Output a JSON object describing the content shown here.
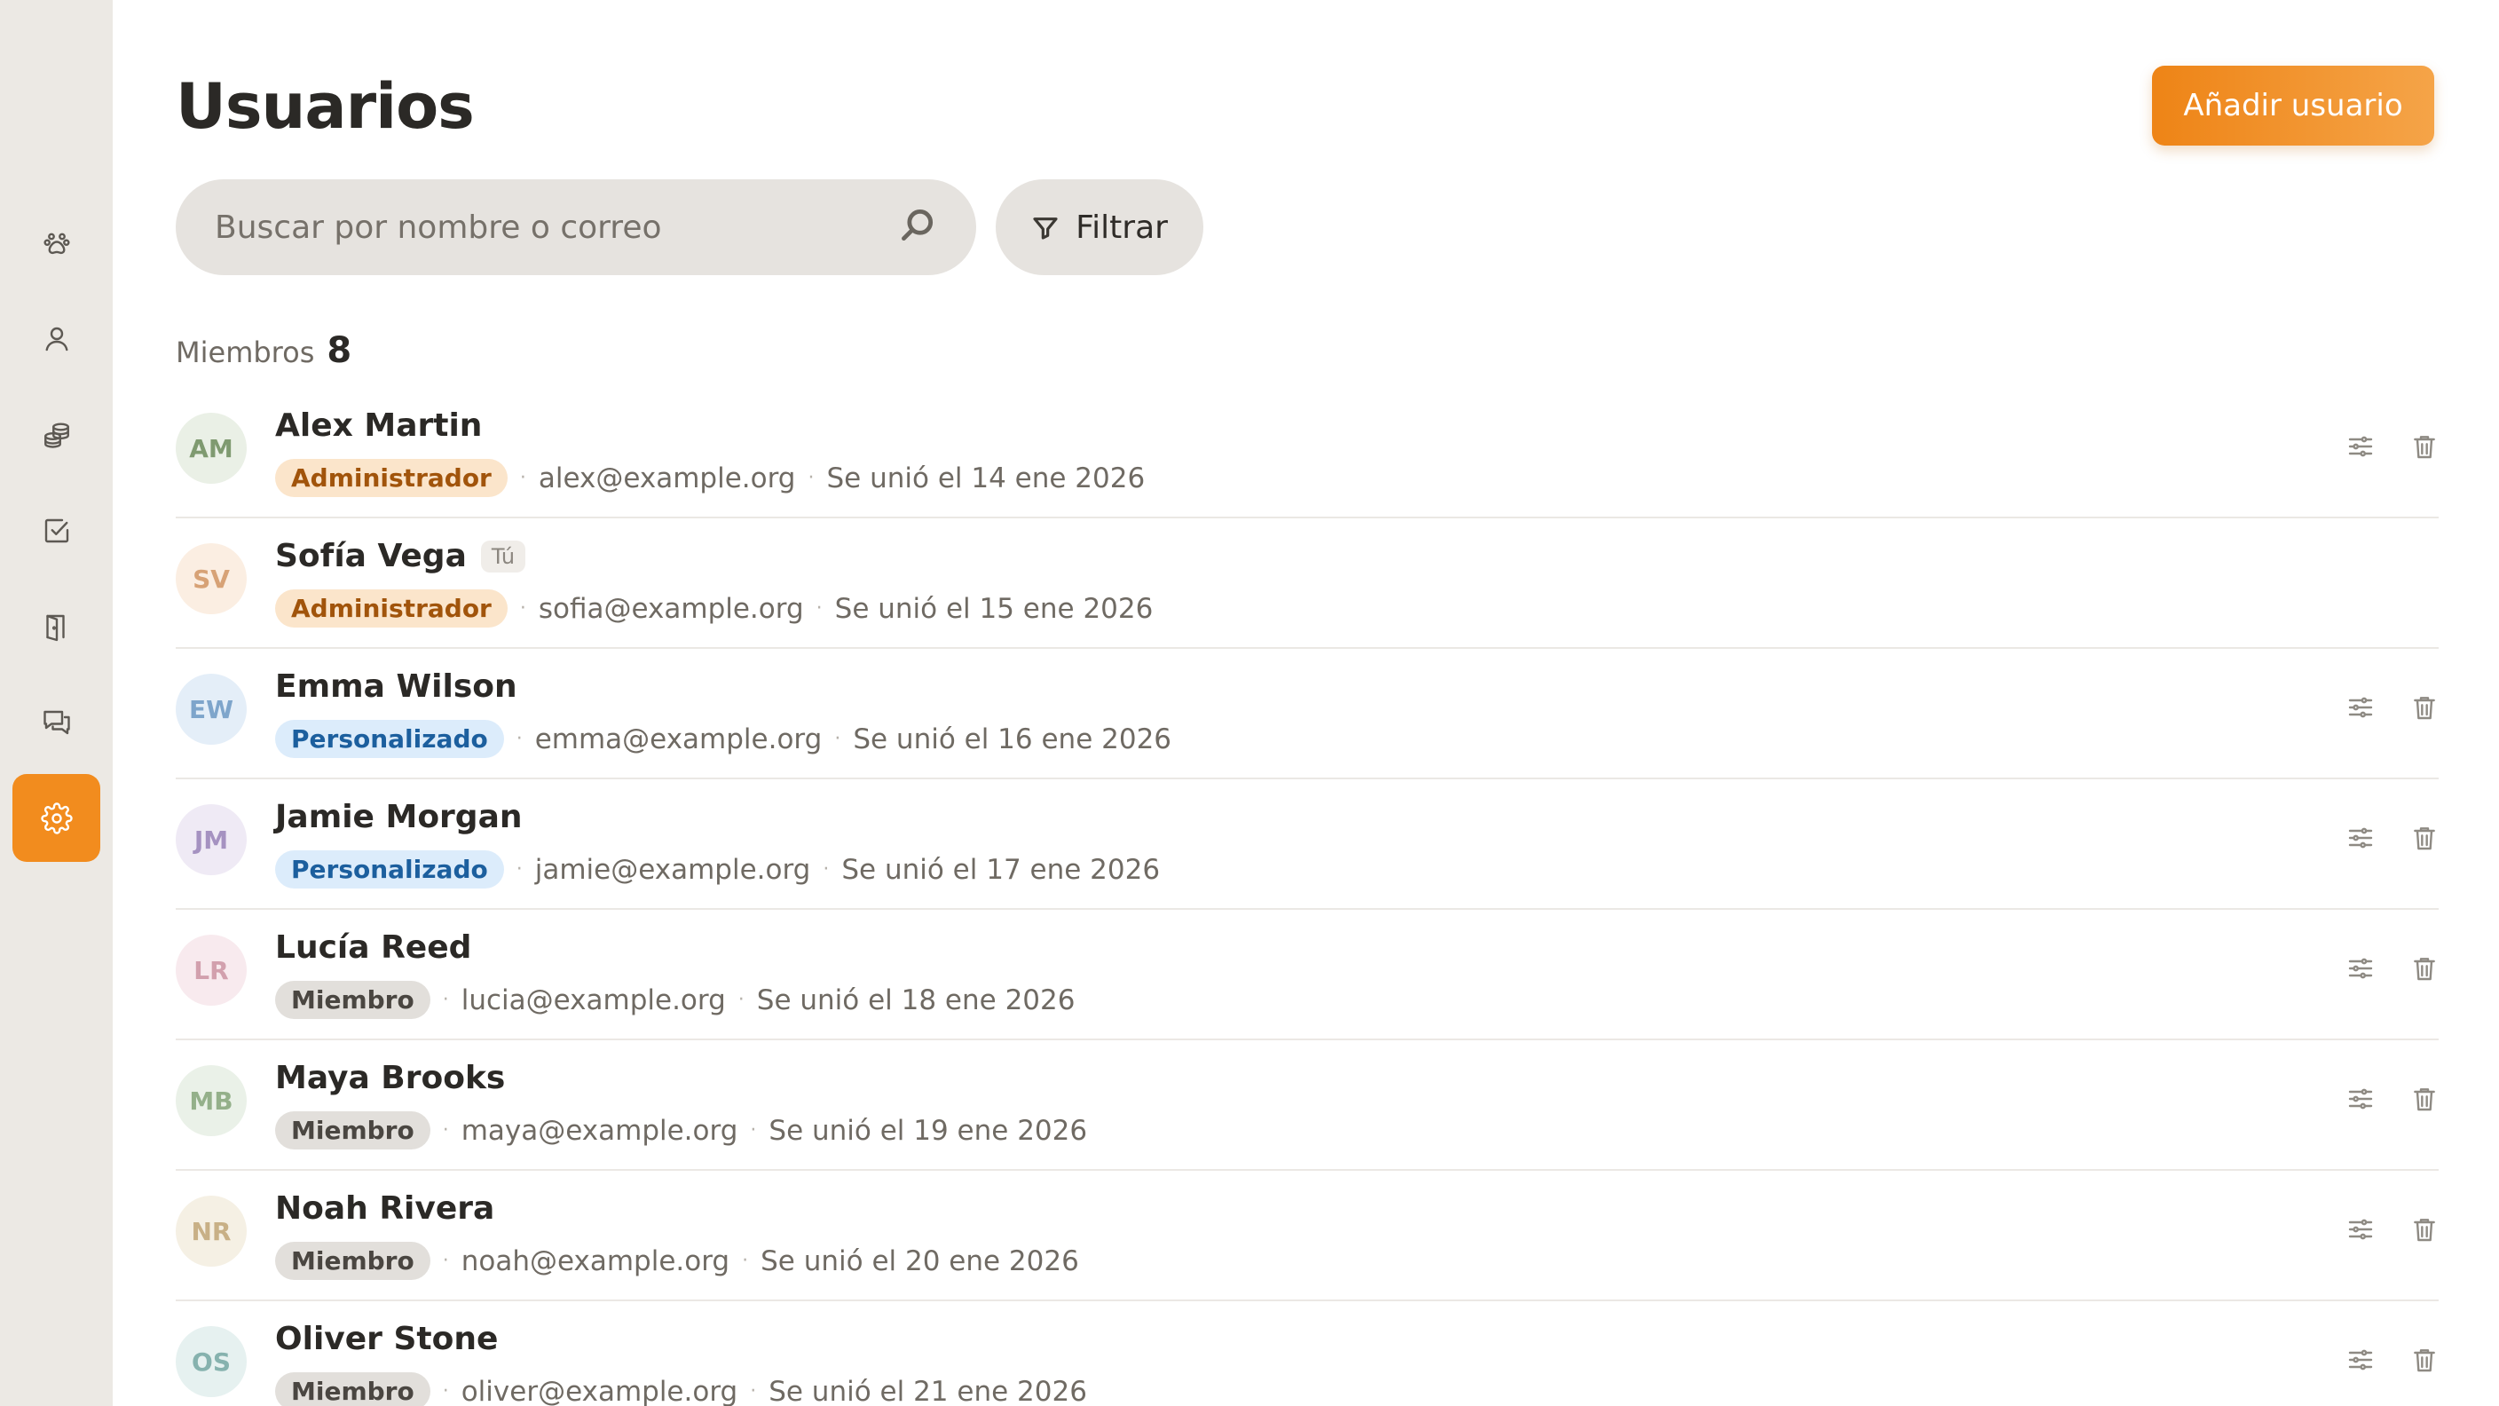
{
  "page": {
    "title": "Usuarios",
    "add_button": "Añadir usuario"
  },
  "search": {
    "placeholder": "Buscar por nombre o correo"
  },
  "filter": {
    "label": "Filtrar"
  },
  "members": {
    "label": "Miembros",
    "count": "8"
  },
  "colors": {
    "accent": "#f28c1e",
    "sidebar_bg": "#ece9e4"
  },
  "sidebar": {
    "items": [
      {
        "icon": "paw-icon",
        "active": false
      },
      {
        "icon": "user-icon",
        "active": false
      },
      {
        "icon": "coins-icon",
        "active": false
      },
      {
        "icon": "checkbox-icon",
        "active": false
      },
      {
        "icon": "door-icon",
        "active": false
      },
      {
        "icon": "chat-icon",
        "active": false
      },
      {
        "icon": "gear-icon",
        "active": true
      }
    ]
  },
  "users": [
    {
      "initials": "AM",
      "name": "Alex Martin",
      "you": "",
      "role": "Administrador",
      "role_type": "admin",
      "email": "alex@example.org",
      "joined": "Se unió el 14 ene 2026",
      "avatar_bg": "#eaf0e6",
      "avatar_fg": "#7f9a70",
      "actions": true
    },
    {
      "initials": "SV",
      "name": "Sofía Vega",
      "you": "Tú",
      "role": "Administrador",
      "role_type": "admin",
      "email": "sofia@example.org",
      "joined": "Se unió el 15 ene 2026",
      "avatar_bg": "#fbeee2",
      "avatar_fg": "#d7a276",
      "actions": false
    },
    {
      "initials": "EW",
      "name": "Emma Wilson",
      "you": "",
      "role": "Personalizado",
      "role_type": "custom",
      "email": "emma@example.org",
      "joined": "Se unió el 16 ene 2026",
      "avatar_bg": "#e4eef8",
      "avatar_fg": "#7ea5cb",
      "actions": true
    },
    {
      "initials": "JM",
      "name": "Jamie Morgan",
      "you": "",
      "role": "Personalizado",
      "role_type": "custom",
      "email": "jamie@example.org",
      "joined": "Se unió el 17 ene 2026",
      "avatar_bg": "#efeaf5",
      "avatar_fg": "#a592c1",
      "actions": true
    },
    {
      "initials": "LR",
      "name": "Lucía Reed",
      "you": "",
      "role": "Miembro",
      "role_type": "member",
      "email": "lucia@example.org",
      "joined": "Se unió el 18 ene 2026",
      "avatar_bg": "#f8eaee",
      "avatar_fg": "#d2a0ad",
      "actions": true
    },
    {
      "initials": "MB",
      "name": "Maya Brooks",
      "you": "",
      "role": "Miembro",
      "role_type": "member",
      "email": "maya@example.org",
      "joined": "Se unió el 19 ene 2026",
      "avatar_bg": "#eaf1e8",
      "avatar_fg": "#94b08a",
      "actions": true
    },
    {
      "initials": "NR",
      "name": "Noah Rivera",
      "you": "",
      "role": "Miembro",
      "role_type": "member",
      "email": "noah@example.org",
      "joined": "Se unió el 20 ene 2026",
      "avatar_bg": "#f5f0e4",
      "avatar_fg": "#c8b086",
      "actions": true
    },
    {
      "initials": "OS",
      "name": "Oliver Stone",
      "you": "",
      "role": "Miembro",
      "role_type": "member",
      "email": "oliver@example.org",
      "joined": "Se unió el 21 ene 2026",
      "avatar_bg": "#e6f1f0",
      "avatar_fg": "#86b2ae",
      "actions": true
    }
  ]
}
